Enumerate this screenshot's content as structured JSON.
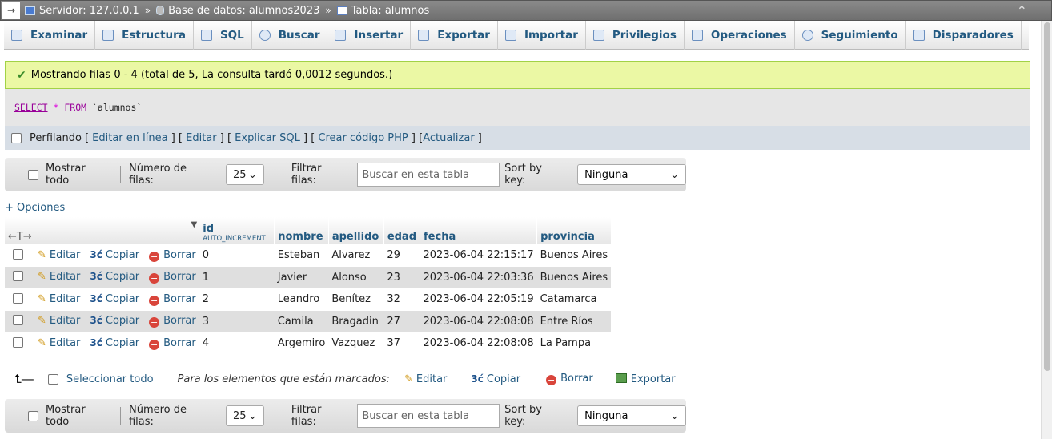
{
  "titlebar": {
    "server": "Servidor: 127.0.0.1",
    "database": "Base de datos: alumnos2023",
    "table": "Tabla: alumnos"
  },
  "tabs": [
    "Examinar",
    "Estructura",
    "SQL",
    "Buscar",
    "Insertar",
    "Exportar",
    "Importar",
    "Privilegios",
    "Operaciones",
    "Seguimiento",
    "Disparadores"
  ],
  "message": "Mostrando filas 0 - 4 (total de 5, La consulta tardó 0,0012 segundos.)",
  "sql": {
    "select": "SELECT",
    "star": "*",
    "from": "FROM",
    "table": "`alumnos`"
  },
  "profiling": {
    "label": "Perfilando",
    "links": [
      "Editar en línea",
      "Editar",
      "Explicar SQL",
      "Crear código PHP",
      "Actualizar"
    ]
  },
  "nav": {
    "show_all": "Mostrar todo",
    "rows_label": "Número de filas:",
    "rows_value": "25",
    "filter_label": "Filtrar filas:",
    "filter_placeholder": "Buscar en esta tabla",
    "sort_label": "Sort by key:",
    "sort_value": "Ninguna"
  },
  "options_link": "+ Opciones",
  "table": {
    "id_header": "id",
    "id_sub": "AUTO_INCREMENT",
    "headers": [
      "nombre",
      "apellido",
      "edad",
      "fecha",
      "provincia"
    ],
    "actions": {
      "edit": "Editar",
      "copy": "Copiar",
      "delete": "Borrar"
    },
    "rows": [
      {
        "id": "0",
        "nombre": "Esteban",
        "apellido": "Alvarez",
        "edad": "29",
        "fecha": "2023-06-04 22:15:17",
        "provincia": "Buenos Aires"
      },
      {
        "id": "1",
        "nombre": "Javier",
        "apellido": "Alonso",
        "edad": "23",
        "fecha": "2023-06-04 22:03:36",
        "provincia": "Buenos Aires"
      },
      {
        "id": "2",
        "nombre": "Leandro",
        "apellido": "Benítez",
        "edad": "32",
        "fecha": "2023-06-04 22:05:19",
        "provincia": "Catamarca"
      },
      {
        "id": "3",
        "nombre": "Camila",
        "apellido": "Bragadin",
        "edad": "27",
        "fecha": "2023-06-04 22:08:08",
        "provincia": "Entre Ríos"
      },
      {
        "id": "4",
        "nombre": "Argemiro",
        "apellido": "Vazquez",
        "edad": "37",
        "fecha": "2023-06-04 22:08:08",
        "provincia": "La Pampa"
      }
    ]
  },
  "bulk": {
    "select_all": "Seleccionar todo",
    "with_selected": "Para los elementos que están marcados:",
    "edit": "Editar",
    "copy": "Copiar",
    "delete": "Borrar",
    "export": "Exportar"
  }
}
